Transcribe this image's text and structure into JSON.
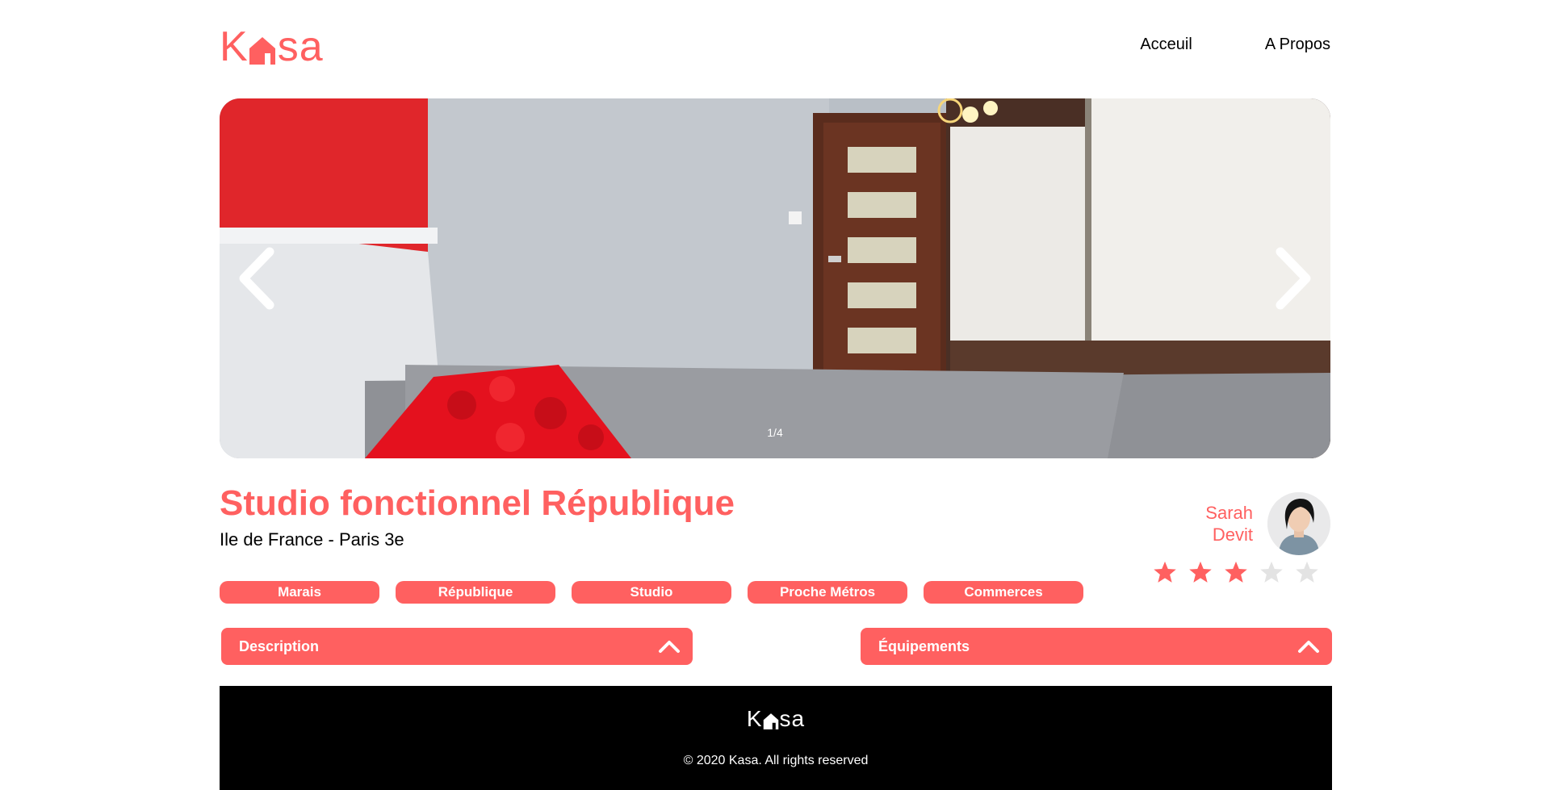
{
  "brand": {
    "k": "K",
    "sa": "sa",
    "color": "#FF6060"
  },
  "nav": {
    "home": "Acceuil",
    "about": "A Propos"
  },
  "carousel": {
    "counter": "1/4"
  },
  "listing": {
    "title": "Studio fonctionnel République",
    "location": "Ile de France - Paris 3e",
    "tags": [
      "Marais",
      "République",
      "Studio",
      "Proche Métros",
      "Commerces"
    ],
    "rating": {
      "value": 3,
      "max": 5
    }
  },
  "host": {
    "first_name": "Sarah",
    "last_name": "Devit"
  },
  "collapses": {
    "description": "Description",
    "equipment": "Équipements"
  },
  "footer": {
    "copyright": "© 2020 Kasa. All rights reserved"
  },
  "icons": {
    "prev": "chevron-left-icon",
    "next": "chevron-right-icon",
    "star": "star-icon",
    "collapse": "chevron-up-icon"
  }
}
